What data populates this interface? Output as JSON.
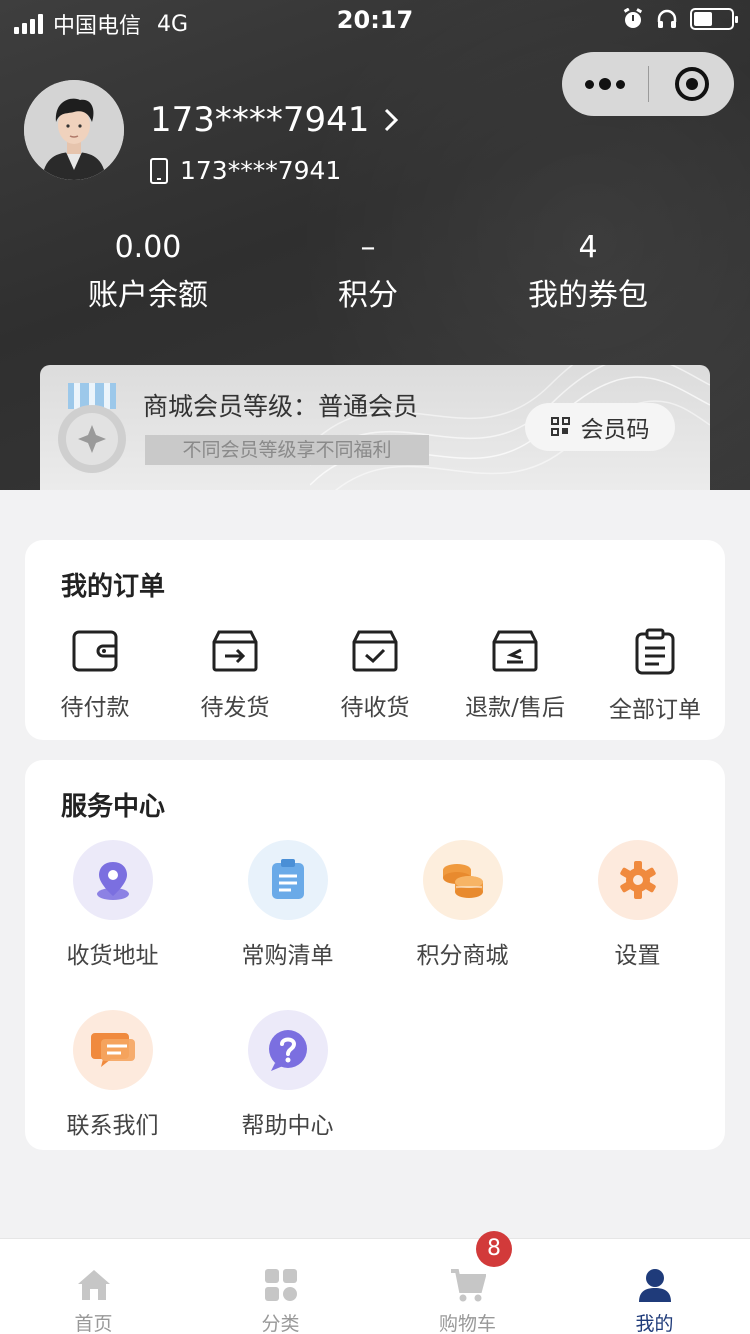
{
  "status_bar": {
    "carrier": "中国电信",
    "network": "4G",
    "time": "20:17"
  },
  "profile": {
    "username": "173****7941",
    "phone": "173****7941"
  },
  "stats": [
    {
      "value": "0.00",
      "label": "账户余额"
    },
    {
      "value": "–",
      "label": "积分"
    },
    {
      "value": "4",
      "label": "我的券包"
    }
  ],
  "member": {
    "title": "商城会员等级：普通会员",
    "subtitle": "不同会员等级享不同福利",
    "code_button": "会员码"
  },
  "orders": {
    "title": "我的订单",
    "items": [
      {
        "label": "待付款",
        "icon": "wallet-icon"
      },
      {
        "label": "待发货",
        "icon": "box-arrow-icon"
      },
      {
        "label": "待收货",
        "icon": "box-check-icon"
      },
      {
        "label": "退款/售后",
        "icon": "box-return-icon"
      },
      {
        "label": "全部订单",
        "icon": "clipboard-list-icon"
      }
    ]
  },
  "services": {
    "title": "服务中心",
    "items": [
      {
        "label": "收货地址",
        "icon": "location-pin-icon",
        "color": "#7b6fe0"
      },
      {
        "label": "常购清单",
        "icon": "clipboard-icon",
        "color": "#6aaae8"
      },
      {
        "label": "积分商城",
        "icon": "coins-icon",
        "color": "#f09a3e"
      },
      {
        "label": "设置",
        "icon": "gear-icon",
        "color": "#f08a3e"
      },
      {
        "label": "联系我们",
        "icon": "chat-icon",
        "color": "#f08a3e"
      },
      {
        "label": "帮助中心",
        "icon": "question-icon",
        "color": "#7b6fe0"
      }
    ]
  },
  "tabbar": {
    "items": [
      {
        "label": "首页",
        "icon": "home-icon"
      },
      {
        "label": "分类",
        "icon": "grid-icon"
      },
      {
        "label": "购物车",
        "icon": "cart-icon"
      },
      {
        "label": "我的",
        "icon": "user-icon"
      }
    ],
    "active": "我的",
    "cart_badge": "8"
  },
  "colors": {
    "header_bg": "#363636",
    "active_tab": "#1f3b7a",
    "badge": "#d23a3a"
  }
}
